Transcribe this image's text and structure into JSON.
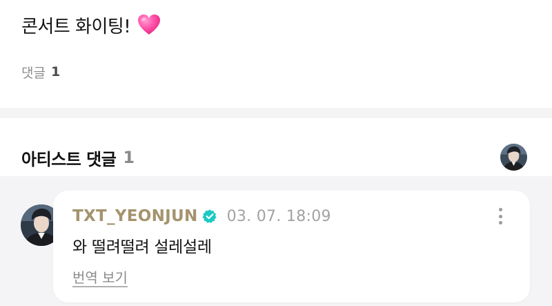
{
  "post": {
    "text": "콘서트 화이팅!",
    "emoji_icon": "pink-heart-icon",
    "comment_count_label": "댓글",
    "comment_count": "1"
  },
  "artist_comments": {
    "title": "아티스트 댓글",
    "count": "1",
    "header_avatar_icon": "artist-avatar"
  },
  "comments": [
    {
      "author": "TXT_YEONJUN",
      "verified": true,
      "timestamp": "03. 07. 18:09",
      "text": "와 떨려떨려 설레설레",
      "translate_label": "번역 보기",
      "more_icon": "more-vertical-icon"
    }
  ],
  "colors": {
    "author_name": "#a4936d",
    "verified_badge": "#1dc9c4",
    "heart": "#ff4fa8",
    "section_background": "#f4f4f6"
  }
}
